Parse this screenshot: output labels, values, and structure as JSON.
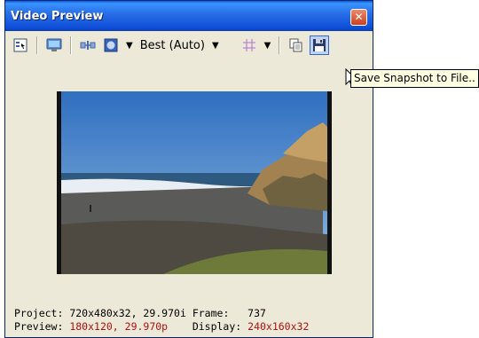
{
  "window": {
    "title": "Video Preview"
  },
  "toolbar": {
    "quality_label": "Best (Auto)"
  },
  "tooltip": {
    "text": "Save Snapshot to File.."
  },
  "status": {
    "project_label": "Project:",
    "project_value": "720x480x32, 29.970i",
    "frame_label": "Frame:",
    "frame_value": "737",
    "preview_label": "Preview:",
    "preview_value": "180x120, 29.970p",
    "display_label": "Display:",
    "display_value": "240x160x32"
  },
  "colors": {
    "title_bar": "#0a58e0",
    "window_bg": "#ece9d8",
    "status_red": "#b01010",
    "tooltip_bg": "#ffffe1"
  }
}
